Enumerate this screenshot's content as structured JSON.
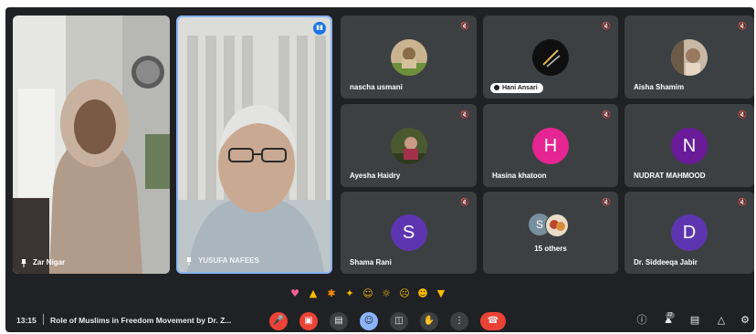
{
  "colors": {
    "background": "#202124",
    "tile": "#3c4043",
    "avatar_h": "#e52592",
    "avatar_purple": "#6a1b9a",
    "control_red": "#ea4335",
    "control_blue": "#8ab4f8"
  },
  "tiles": {
    "zar_nigar": {
      "name": "Zar Nigar"
    },
    "yusuf": {
      "name": "YUSUFA NAFEES"
    },
    "nascha": {
      "name": "nascha usmani"
    },
    "hani": {
      "name": "Hani Ansari"
    },
    "aisha": {
      "name": "Aisha Shamim"
    },
    "ayesha": {
      "name": "Ayesha Haidry"
    },
    "hasina": {
      "name": "Hasina khatoon",
      "initial": "H"
    },
    "nudrat": {
      "name": "NUDRAT MAHMOOD",
      "initial": "N"
    },
    "shama": {
      "name": "Shama Rani",
      "initial": "S"
    },
    "others": {
      "name": "15 others",
      "initial": "S"
    },
    "siddeeqa": {
      "name": "Dr. Siddeeqa Jabir",
      "initial": "D"
    }
  },
  "reactions": [
    "heart",
    "thumbs-up",
    "party-popper",
    "clapping-hands",
    "laughing",
    "surprised",
    "crying",
    "thinking",
    "thumbs-down"
  ],
  "bottombar": {
    "time": "13:15",
    "separator": "|",
    "meeting_title": "Role of Muslims in Freedom Movement by Dr. Z...",
    "participant_count": "22"
  },
  "controls": [
    "mic-off-icon",
    "camera-off-icon",
    "captions-icon",
    "emoji-icon",
    "present-icon",
    "raise-hand-icon",
    "more-options-icon",
    "leave-call-icon"
  ],
  "right_controls": [
    "info-icon",
    "people-icon",
    "chat-icon",
    "activities-icon",
    "host-controls-icon"
  ]
}
